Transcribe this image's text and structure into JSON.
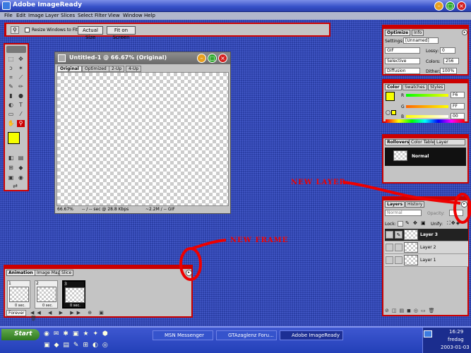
{
  "app": {
    "title": "Adobe ImageReady"
  },
  "menu": [
    "File",
    "Edit",
    "Image",
    "Layer",
    "Slices",
    "Select",
    "Filter",
    "View",
    "Window",
    "Help"
  ],
  "options_bar": {
    "checkbox_label": "Resize Windows to Fit",
    "btn_actual": "Actual Size",
    "btn_fit": "Fit on Screen"
  },
  "document": {
    "title": "Untitled-1 @ 66.67% (Original)",
    "tabs": [
      "Original",
      "Optimized",
      "2-Up",
      "4-Up"
    ],
    "zoom": "66.67%",
    "status1": "-- / -- sec @ 28.8 Kbps",
    "status2": "~2.2M / -- GIF"
  },
  "optimize": {
    "tabs": [
      "Optimize",
      "Info"
    ],
    "settings_label": "Settings:",
    "settings_value": "[Unnamed]",
    "format": "GIF",
    "lossy_label": "Lossy:",
    "lossy_value": "0",
    "palette": "Selective",
    "colors_label": "Colors:",
    "colors_value": "256",
    "dither_method": "Diffusion",
    "dither_label": "Dither:",
    "dither_value": "100%"
  },
  "color": {
    "tabs": [
      "Color",
      "Swatches",
      "Styles"
    ],
    "r_label": "R",
    "g_label": "G",
    "b_label": "B",
    "r_value": "F6",
    "g_value": "FF",
    "b_value": "00",
    "fg": "#F6FF00"
  },
  "rollovers": {
    "tabs": [
      "Rollovers",
      "Color Table",
      "Layer Options"
    ],
    "state": "Normal"
  },
  "layers": {
    "tabs": [
      "Layers",
      "History"
    ],
    "blend": "Normal",
    "opacity_label": "Opacity:",
    "lock_label": "Lock:",
    "unify_label": "Unify:",
    "rows": [
      {
        "name": "Layer 3",
        "active": true
      },
      {
        "name": "Layer 2",
        "active": false
      },
      {
        "name": "Layer 1",
        "active": false
      }
    ]
  },
  "animation": {
    "tabs": [
      "Animation",
      "Image Map",
      "Slice"
    ],
    "frames": [
      {
        "num": "1",
        "delay": "0 sec."
      },
      {
        "num": "2",
        "delay": "0 sec."
      },
      {
        "num": "3",
        "delay": "0 sec."
      }
    ],
    "loop": "Forever"
  },
  "annotations": {
    "new_layer": "NEW LAYER",
    "new_frame": "NEW FRAME"
  },
  "taskbar": {
    "start": "Start",
    "tasks": [
      "MSN Messenger",
      "GTAzaglenz Foru...",
      "Adobe ImageReady"
    ],
    "time": "16:29",
    "day": "fredag",
    "date": "2003-01-03"
  }
}
